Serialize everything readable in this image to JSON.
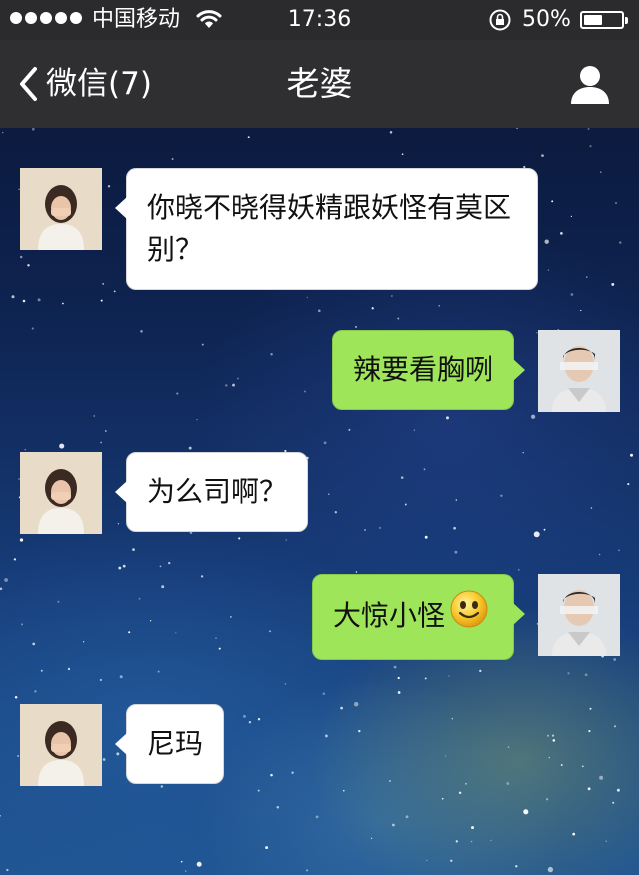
{
  "status_bar": {
    "carrier": "中国移动",
    "time": "17:36",
    "battery_percent_text": "50%",
    "battery_level": 0.5,
    "signal_icon": "signal-dots-icon",
    "wifi_icon": "wifi-icon",
    "rotation_lock_icon": "rotation-lock-icon"
  },
  "nav": {
    "back_label": "微信(7)",
    "title": "老婆",
    "back_icon": "chevron-left-icon",
    "profile_icon": "person-icon"
  },
  "messages": [
    {
      "sender": "contact",
      "text": "你晓不晓得妖精跟妖怪有莫区别？"
    },
    {
      "sender": "me",
      "text": "辣要看胸咧"
    },
    {
      "sender": "contact",
      "text": "为么司啊？"
    },
    {
      "sender": "me",
      "text": "大惊小怪",
      "emoji": "smiley-emoji"
    },
    {
      "sender": "contact",
      "text": "尼玛"
    }
  ],
  "colors": {
    "header_bg": "#2f2f31",
    "statusbar_bg": "#2b2b2d",
    "incoming_bubble": "#ffffff",
    "outgoing_bubble": "#9fe55a"
  }
}
